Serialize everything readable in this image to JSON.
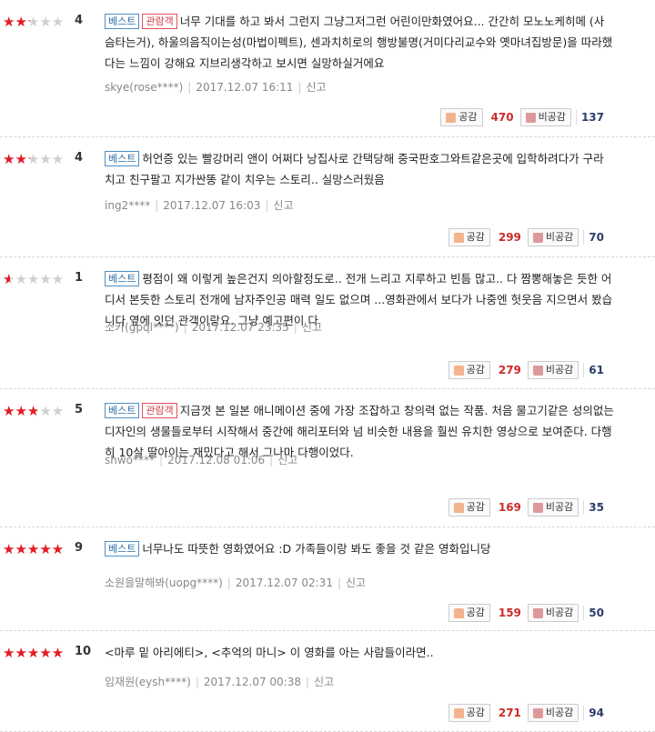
{
  "ui": {
    "like_label": "공감",
    "dislike_label": "비공감",
    "report_label": "신고",
    "star_glyphs": "★★★★★"
  },
  "reviews": [
    {
      "score": "4",
      "rating_fraction": 0.4,
      "badges": [
        "베스트",
        "관람객"
      ],
      "text": "너무 기대를 하고 봐서 그런지 그냥그저그런 어린이만화였어요... 간간히 모노노케히메 (사슴타는거), 하울의음직이는성(마법이펙트), 센과치히로의 행방불명(거미다리교수와 옛마녀집방문)을 따라했다는 느낌이 강해요 지브리생각하고 보시면 실망하실거에요",
      "author": "skye(rose****)",
      "date": "2017.12.07 16:11",
      "likes": "470",
      "dislikes": "137"
    },
    {
      "score": "4",
      "rating_fraction": 0.4,
      "badges": [
        "베스트"
      ],
      "text": "허언증 있는 빨강머리 앤이 어쩌다 낭집사로 간택당해 중국판호그와트같은곳에 입학하려다가 구라치고 친구팔고 지가싼똥 같이 치우는 스토리.. 실망스러웠음",
      "author": "ing2****",
      "date": "2017.12.07 16:03",
      "likes": "299",
      "dislikes": "70"
    },
    {
      "score": "1",
      "rating_fraction": 0.1,
      "badges": [
        "베스트"
      ],
      "text": "평점이 왜 이렇게 높은건지 의아할정도로.. 전개 느리고 지루하고 빈틈 많고.. 다 짬뽕해놓은 듯한 어디서 본듯한 스토리 전개에 남자주인공 매력 일도 없으며 ...영화관에서 보다가 나중엔 헛웃음 지으면서 봤습니다 옆에 잇던 관객이랑요. 그냥 예고편이 다",
      "author": "소카(gpql****)",
      "date": "2017.12.07 23:35",
      "likes": "279",
      "dislikes": "61"
    },
    {
      "score": "5",
      "rating_fraction": 0.5,
      "badges": [
        "베스트",
        "관람객"
      ],
      "text": "지금껏 본 일본 애니메이션 중에 가장 조잡하고 창의력 없는 작품. 처음 물고기같은 성의없는 디자인의 생물들로부터 시작해서 중간에 해리포터와 넘 비슷한 내용을 훨씬 유치한 영상으로 보여준다. 다행히 10살 딸아이는 재밌다고 해서 그나마 다행이었다.",
      "author": "shwo****",
      "date": "2017.12.08 01:06",
      "likes": "169",
      "dislikes": "35"
    },
    {
      "score": "9",
      "rating_fraction": 0.9,
      "badges": [
        "베스트"
      ],
      "text": "너무나도 따뜻한 영화였어요 :D 가족들이랑 봐도 좋을 것 같은 영화입니당",
      "author": "소원을말해봐(uopg****)",
      "date": "2017.12.07 02:31",
      "likes": "159",
      "dislikes": "50"
    },
    {
      "score": "10",
      "rating_fraction": 1.0,
      "badges": [],
      "text": "<마루 밑 아리에티>, <추억의 마니> 이 영화를 아는 사람들이라면..",
      "author": "임재원(eysh****)",
      "date": "2017.12.07 00:38",
      "likes": "271",
      "dislikes": "94"
    }
  ]
}
